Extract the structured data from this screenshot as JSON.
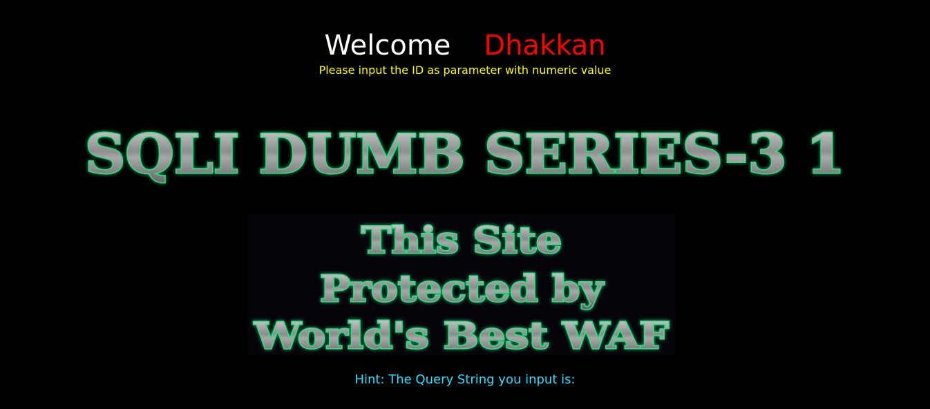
{
  "greeting": {
    "welcome": "Welcome",
    "name": "Dhakkan"
  },
  "subtitle": "Please input the ID as parameter with numeric value",
  "banner": {
    "title": "SQLI DUMB SERIES-3 1"
  },
  "waf_image": {
    "line1": "This Site",
    "line2": "Protected by",
    "line3": "World's Best WAF"
  },
  "hint": "Hint: The Query String you input is:",
  "colors": {
    "background": "#000000",
    "welcome": "#ffffff",
    "name": "#ff0000",
    "subtitle": "#ffff00",
    "hint": "#33ddff",
    "glow": "#3bd98a"
  }
}
